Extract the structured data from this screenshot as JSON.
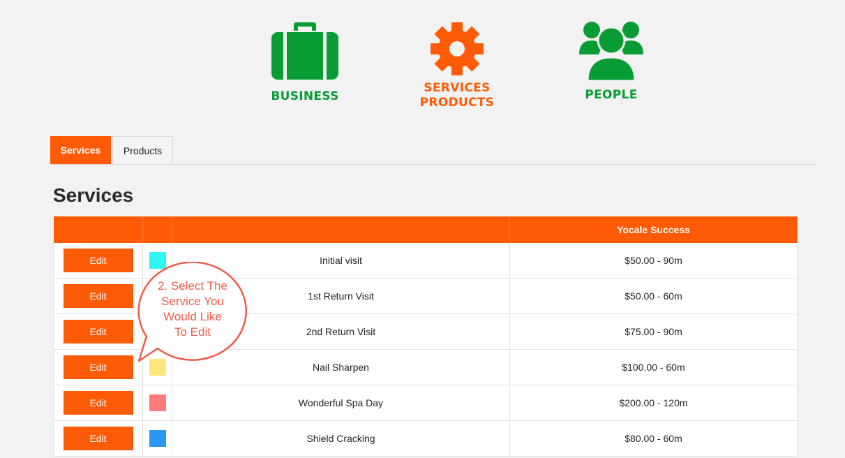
{
  "nav": {
    "business": {
      "label": "BUSINESS",
      "icon": "briefcase-icon",
      "color": "#0a9c34"
    },
    "services_products": {
      "line1": "SERVICES",
      "line2": "PRODUCTS",
      "icon": "gear-icon",
      "color": "#ff5a05"
    },
    "people": {
      "label": "PEOPLE",
      "icon": "people-icon",
      "color": "#0a9c34"
    }
  },
  "tabs": {
    "services": "Services",
    "products": "Products"
  },
  "page_title": "Services",
  "table": {
    "header_location": "Yocale Success",
    "edit_label": "Edit",
    "rows": [
      {
        "color": "#2ef6f3",
        "name": "Initial visit",
        "price": "$50.00 - 90m"
      },
      {
        "color": "",
        "name": "1st Return Visit",
        "price": "$50.00 - 60m"
      },
      {
        "color": "",
        "name": "2nd Return Visit",
        "price": "$75.00 - 90m"
      },
      {
        "color": "#fbe77c",
        "name": "Nail Sharpen",
        "price": "$100.00 - 60m"
      },
      {
        "color": "#ff7b7b",
        "name": "Wonderful Spa Day",
        "price": "$200.00 - 120m"
      },
      {
        "color": "#2c96f7",
        "name": "Shield Cracking",
        "price": "$80.00 - 60m"
      }
    ]
  },
  "callout": {
    "line1": "2. Select The",
    "line2": "Service You",
    "line3": "Would Like",
    "line4": "To Edit"
  },
  "colors": {
    "accent": "#ff5a05",
    "green": "#0a9c34",
    "callout": "#ee5b4a"
  }
}
